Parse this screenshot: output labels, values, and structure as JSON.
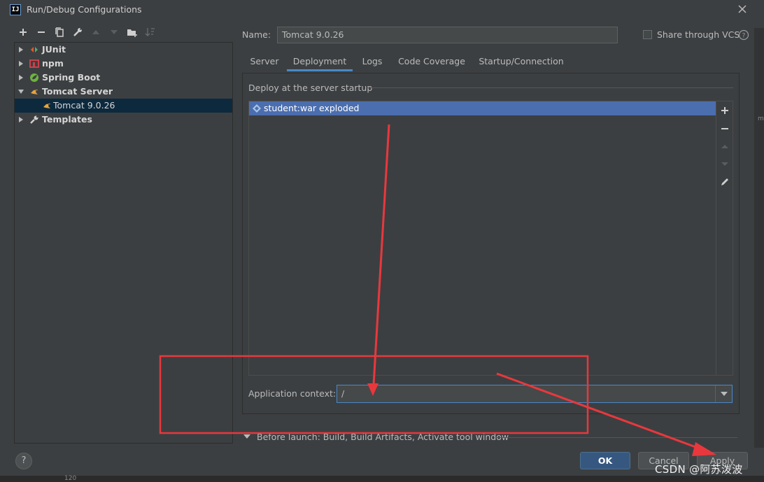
{
  "window": {
    "title": "Run/Debug Configurations",
    "app_icon_text": "IJ"
  },
  "toolbar": {
    "icons": [
      "add-icon",
      "remove-icon",
      "copy-icon",
      "wrench-icon",
      "move-up-icon",
      "move-down-icon",
      "folder-icon",
      "sort-icon"
    ]
  },
  "tree": {
    "items": [
      {
        "label": "JUnit",
        "icon": "junit-icon",
        "expanded": false
      },
      {
        "label": "npm",
        "icon": "npm-icon",
        "expanded": false
      },
      {
        "label": "Spring Boot",
        "icon": "spring-boot-icon",
        "expanded": false
      },
      {
        "label": "Tomcat Server",
        "icon": "tomcat-icon",
        "expanded": true
      },
      {
        "label": "Tomcat 9.0.26",
        "icon": "tomcat-icon",
        "selected": true
      },
      {
        "label": "Templates",
        "icon": "wrench-icon",
        "expanded": false
      }
    ]
  },
  "form": {
    "name_label": "Name:",
    "name_value": "Tomcat 9.0.26",
    "share_label": "Share through VCS",
    "share_checked": false
  },
  "tabs": [
    {
      "label": "Server",
      "active": false
    },
    {
      "label": "Deployment",
      "active": true
    },
    {
      "label": "Logs",
      "active": false
    },
    {
      "label": "Code Coverage",
      "active": false
    },
    {
      "label": "Startup/Connection",
      "active": false
    }
  ],
  "deployment": {
    "section_label": "Deploy at the server startup",
    "artifacts": [
      {
        "label": "student:war exploded",
        "icon": "artifact-icon",
        "selected": true
      }
    ],
    "side_buttons": [
      "add-icon",
      "remove-icon",
      "move-up-icon",
      "move-down-icon",
      "edit-icon"
    ],
    "context_label": "Application context:",
    "context_value": "/"
  },
  "before_launch": {
    "label": "Before launch: Build, Build Artifacts, Activate tool window"
  },
  "footer": {
    "help": "?",
    "ok_label": "OK",
    "cancel_label": "Cancel",
    "apply_label": "Apply"
  },
  "watermark": "CSDN @阿苏泼波",
  "editor": {
    "line_number": "120"
  },
  "colors": {
    "accent": "#4a88c7",
    "selection": "#4b6eaf",
    "annotation": "#e8383d",
    "background": "#3c3f41"
  }
}
